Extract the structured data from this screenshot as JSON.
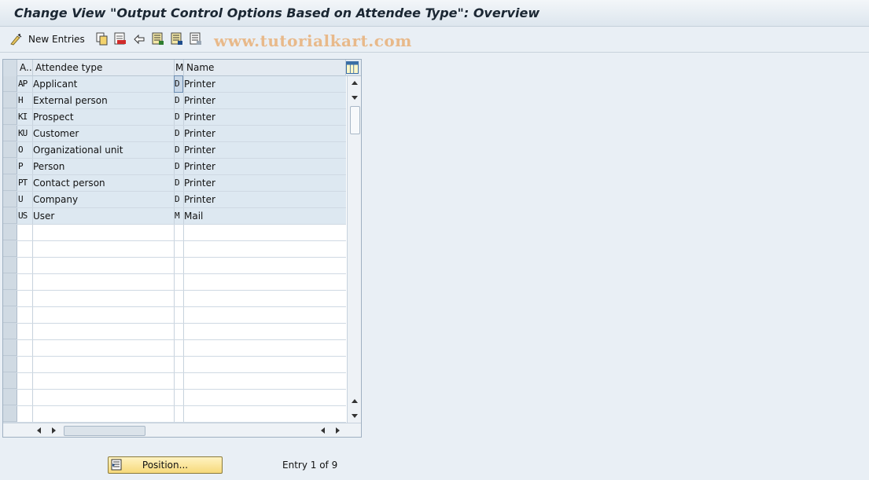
{
  "window": {
    "title": "Change View \"Output Control Options Based on Attendee Type\": Overview"
  },
  "toolbar": {
    "new_entries_label": "New Entries",
    "icons": [
      "new-entries-icon",
      "copy-icon",
      "delete-icon",
      "undo-icon",
      "select-all-icon",
      "select-block-icon",
      "deselect-all-icon"
    ]
  },
  "watermark": "www.tutorialkart.com",
  "table": {
    "headers": {
      "a": "A..",
      "attendee_type": "Attendee type",
      "m": "M",
      "name": "Name"
    },
    "rows": [
      {
        "a": "AP",
        "type": "Applicant",
        "m": "D",
        "name": "Printer"
      },
      {
        "a": "H",
        "type": "External person",
        "m": "D",
        "name": "Printer"
      },
      {
        "a": "KI",
        "type": "Prospect",
        "m": "D",
        "name": "Printer"
      },
      {
        "a": "KU",
        "type": "Customer",
        "m": "D",
        "name": "Printer"
      },
      {
        "a": "O",
        "type": "Organizational unit",
        "m": "D",
        "name": "Printer"
      },
      {
        "a": "P",
        "type": "Person",
        "m": "D",
        "name": "Printer"
      },
      {
        "a": "PT",
        "type": "Contact person",
        "m": "D",
        "name": "Printer"
      },
      {
        "a": "U",
        "type": "Company",
        "m": "D",
        "name": "Printer"
      },
      {
        "a": "US",
        "type": "User",
        "m": "M",
        "name": "Mail"
      }
    ]
  },
  "footer": {
    "position_button_label": "Position...",
    "entry_info": "Entry 1 of 9"
  }
}
